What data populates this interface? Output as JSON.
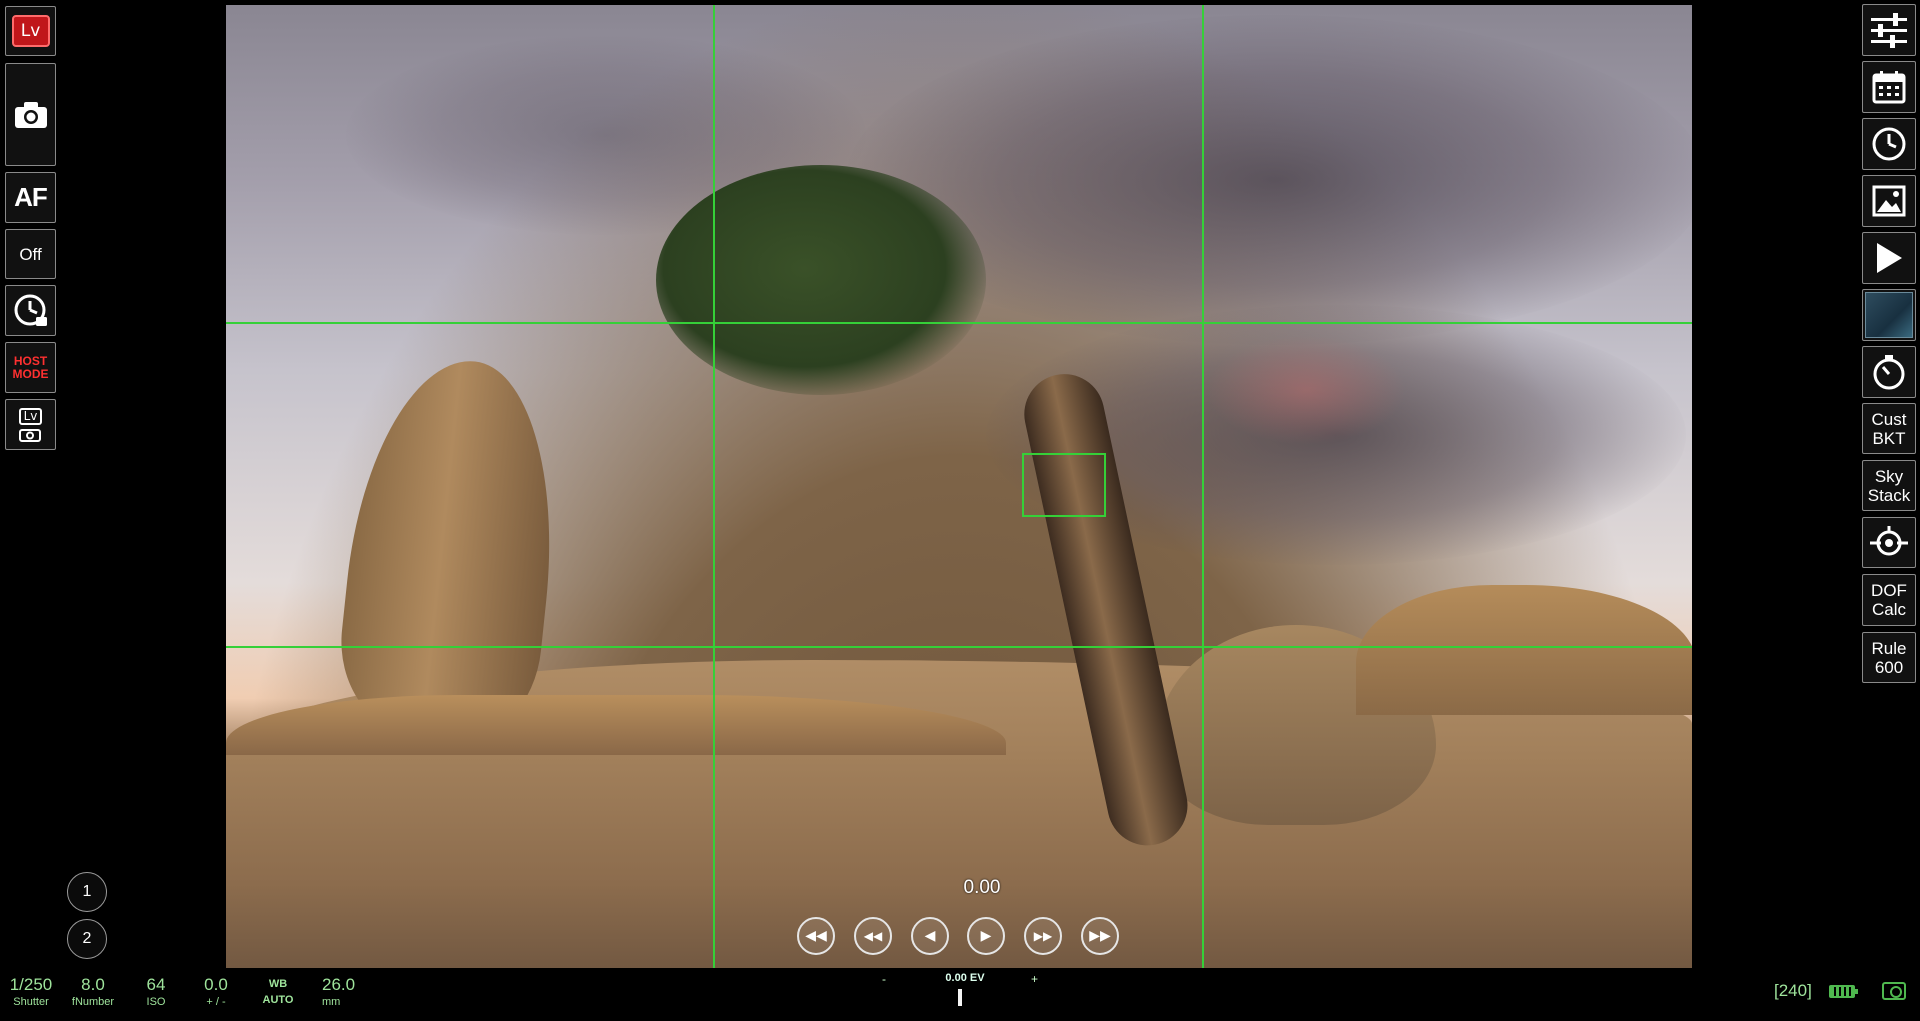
{
  "left_toolbar": {
    "lv_label": "Lv",
    "af_label": "AF",
    "off_label": "Off",
    "host_mode_line1": "HOST",
    "host_mode_line2": "MODE",
    "lv_cam_label": "Lv"
  },
  "right_toolbar": {
    "cust_bkt_line1": "Cust",
    "cust_bkt_line2": "BKT",
    "sky_stack_line1": "Sky",
    "sky_stack_line2": "Stack",
    "dof_calc_line1": "DOF",
    "dof_calc_line2": "Calc",
    "rule600_line1": "Rule",
    "rule600_line2": "600"
  },
  "viewer": {
    "ev_value": "0.00",
    "grid": "rule-of-thirds",
    "grid_color": "#35d038",
    "nav_icons": [
      "fast-rewind-icon",
      "rewind-icon",
      "step-back-icon",
      "step-forward-icon",
      "fast-forward-icon",
      "skip-forward-icon"
    ]
  },
  "presets": [
    "1",
    "2"
  ],
  "status_bar": {
    "shutter_value": "1/250",
    "shutter_label": "Shutter",
    "fnumber_value": "8.0",
    "fnumber_label": "fNumber",
    "iso_value": "64",
    "iso_label": "ISO",
    "exp_comp_value": "0.0",
    "exp_comp_label": "+ / -",
    "wb_label": "WB",
    "wb_value": "AUTO",
    "focal_value": "26.0",
    "focal_label": "mm",
    "ev_minus": "-",
    "ev_readout": "0.00 EV",
    "ev_plus": "+",
    "shots_remaining": "[240]",
    "status_color": "#9fe49c"
  }
}
